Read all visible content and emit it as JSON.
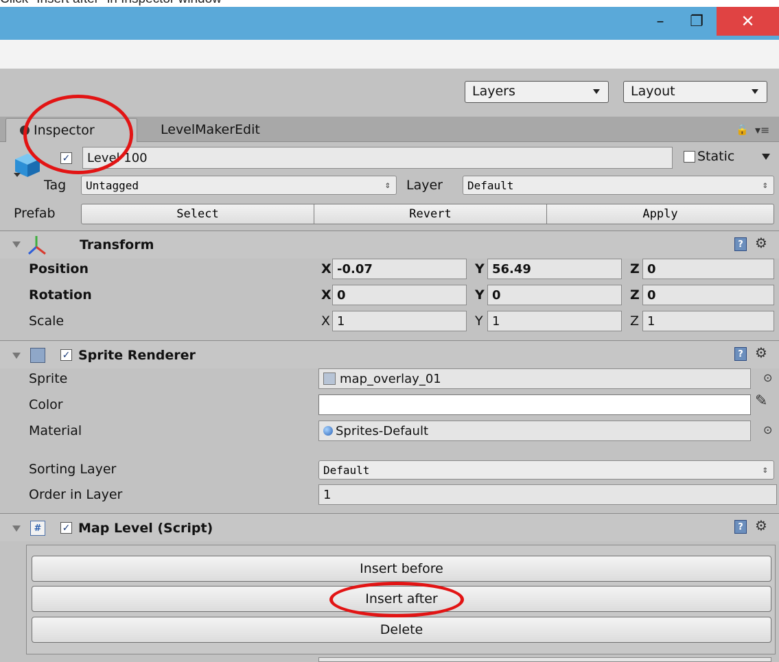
{
  "caption": "Click \"Insert after\" in Inspector window",
  "window": {
    "minimize_glyph": "–",
    "restore_glyph": "❐",
    "close_glyph": "✕"
  },
  "toolbar": {
    "layers_label": "Layers",
    "layout_label": "Layout"
  },
  "tabs": [
    {
      "label": "Inspector",
      "active": true
    },
    {
      "label": "LevelMakerEdit",
      "active": false
    }
  ],
  "gameobject": {
    "active_checked": true,
    "name": "Level 100",
    "static_label": "Static",
    "static_checked": false,
    "tag_label": "Tag",
    "tag_value": "Untagged",
    "layer_label": "Layer",
    "layer_value": "Default",
    "prefab_label": "Prefab",
    "prefab_buttons": [
      "Select",
      "Revert",
      "Apply"
    ]
  },
  "transform": {
    "title": "Transform",
    "rows": [
      {
        "label": "Position",
        "x": "-0.07",
        "y": "56.49",
        "z": "0"
      },
      {
        "label": "Rotation",
        "x": "0",
        "y": "0",
        "z": "0"
      },
      {
        "label": "Scale",
        "x": "1",
        "y": "1",
        "z": "1"
      }
    ],
    "axis_x": "X",
    "axis_y": "Y",
    "axis_z": "Z"
  },
  "sprite_renderer": {
    "title": "Sprite Renderer",
    "enabled": true,
    "sprite_label": "Sprite",
    "sprite_value": "map_overlay_01",
    "color_label": "Color",
    "color_value": "#ffffff",
    "material_label": "Material",
    "material_value": "Sprites-Default",
    "sorting_layer_label": "Sorting Layer",
    "sorting_layer_value": "Default",
    "order_label": "Order in Layer",
    "order_value": "1"
  },
  "map_level": {
    "title": "Map Level (Script)",
    "enabled": true,
    "buttons": [
      "Insert before",
      "Insert after",
      "Delete"
    ]
  },
  "colors": {
    "annotation": "#e21414",
    "titlebar": "#5aa9d9",
    "close": "#e04343",
    "panel": "#c2c2c2"
  }
}
